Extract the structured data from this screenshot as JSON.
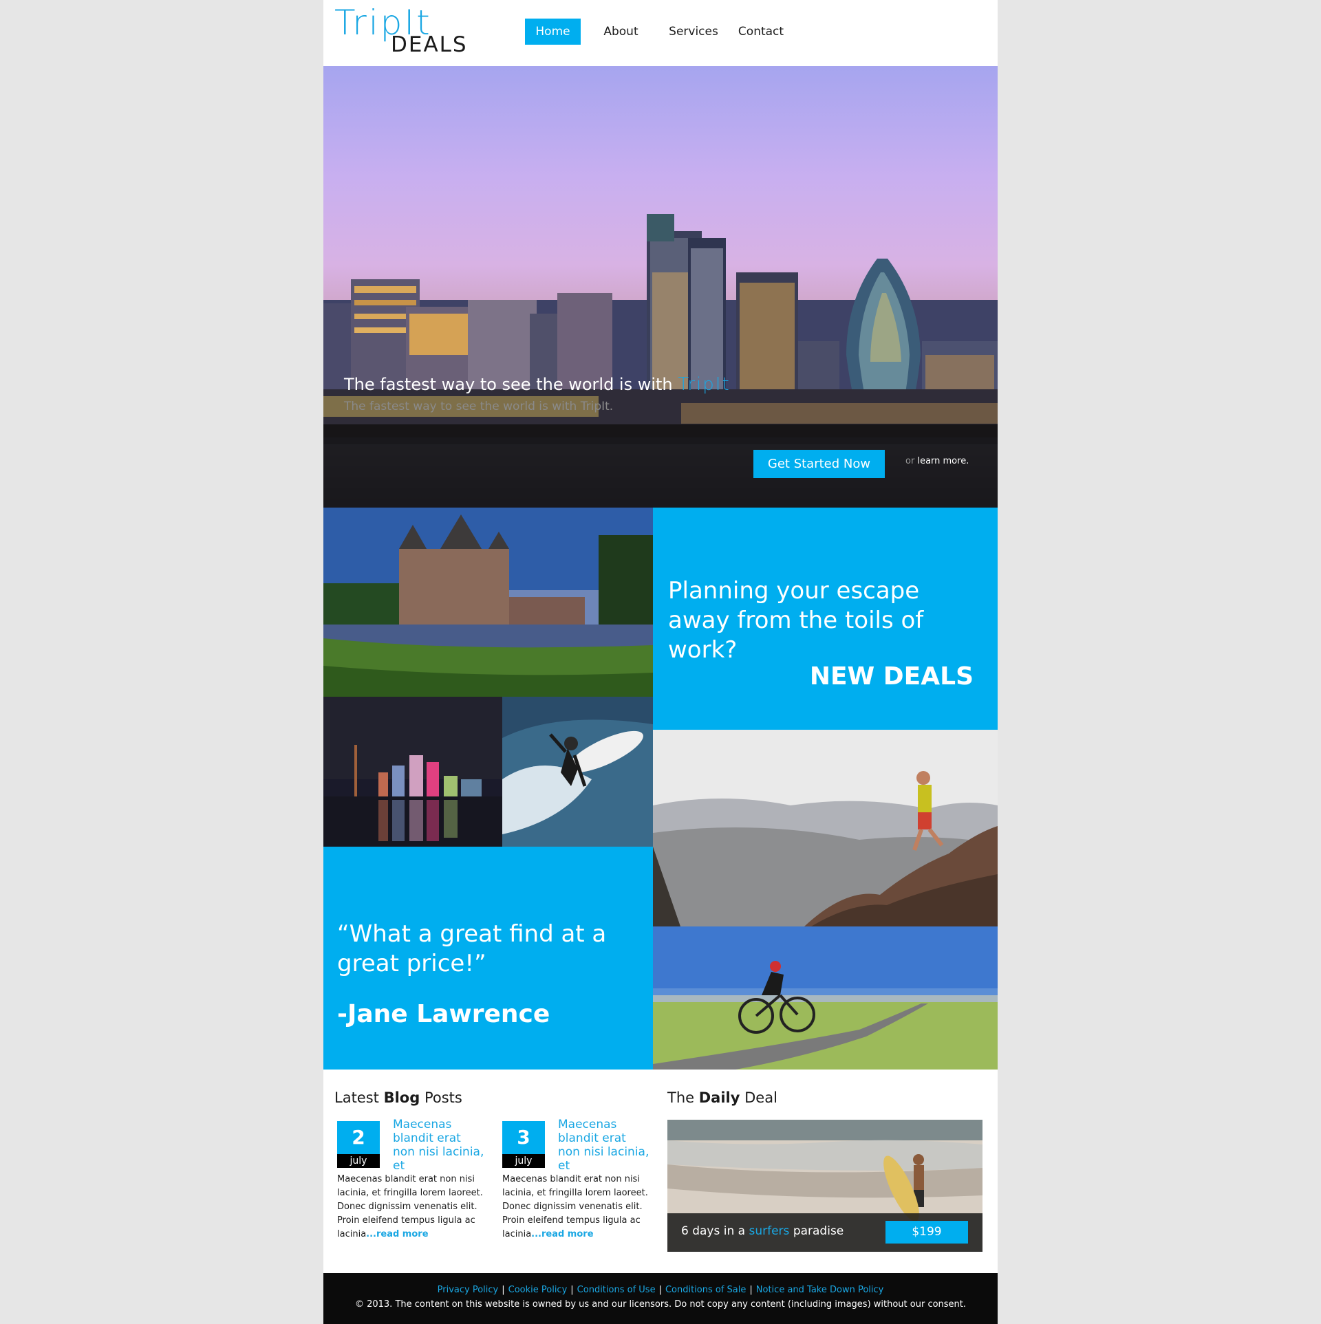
{
  "header": {
    "logo_top": "TripIt",
    "logo_bottom": "DEALS",
    "nav": [
      {
        "label": "Home",
        "active": true
      },
      {
        "label": "About",
        "active": false
      },
      {
        "label": "Services",
        "active": false
      },
      {
        "label": "Contact",
        "active": false
      }
    ]
  },
  "hero": {
    "headline": "The fastest way to see the world is with",
    "headline_brand": "TripIt",
    "subheadline": "The fastest way to see the world is with TripIt.",
    "cta_label": "Get Started Now",
    "learn_prefix": "or",
    "learn_link": "learn more."
  },
  "promo": {
    "planning_text": "Planning your escape away from the toils of work?",
    "new_deals": "NEW DEALS"
  },
  "testimonial": {
    "quote": "“What a great find at a great price!”",
    "author": "-Jane Lawrence"
  },
  "blog": {
    "title_prefix": "Latest",
    "title_bold": "Blog",
    "title_suffix": "Posts",
    "posts": [
      {
        "day": "2",
        "month": "july",
        "title": "Maecenas blandit erat non nisi lacinia, et",
        "body": "Maecenas blandit erat non nisi lacinia, et fringilla lorem laoreet. Donec dignissim venenatis elit. Proin eleifend tempus ligula ac lacinia",
        "more": "...read more"
      },
      {
        "day": "3",
        "month": "july",
        "title": "Maecenas blandit erat non nisi lacinia, et",
        "body": "Maecenas blandit erat non nisi lacinia, et fringilla lorem laoreet. Donec dignissim venenatis elit. Proin eleifend tempus ligula ac lacinia",
        "more": "...read more"
      }
    ]
  },
  "daily_deal": {
    "title_prefix": "The",
    "title_bold": "Daily",
    "title_suffix": "Deal",
    "text_prefix": "6 days in a",
    "text_highlight": "surfers",
    "text_suffix": "paradise",
    "price": "$199"
  },
  "footer": {
    "links": [
      "Privacy Policy",
      "Cookie Policy",
      "Conditions of Use",
      "Conditions of Sale",
      "Notice and Take Down Policy"
    ],
    "separator": "|",
    "copyright": "© 2013. The content on this website is owned by us and our licensors. Do not copy any content (including images) without our consent."
  },
  "colors": {
    "accent": "#00aeef",
    "brand_text": "#1aa7e3",
    "dark_bar": "#141212",
    "page_bg": "#e6e6e6"
  }
}
